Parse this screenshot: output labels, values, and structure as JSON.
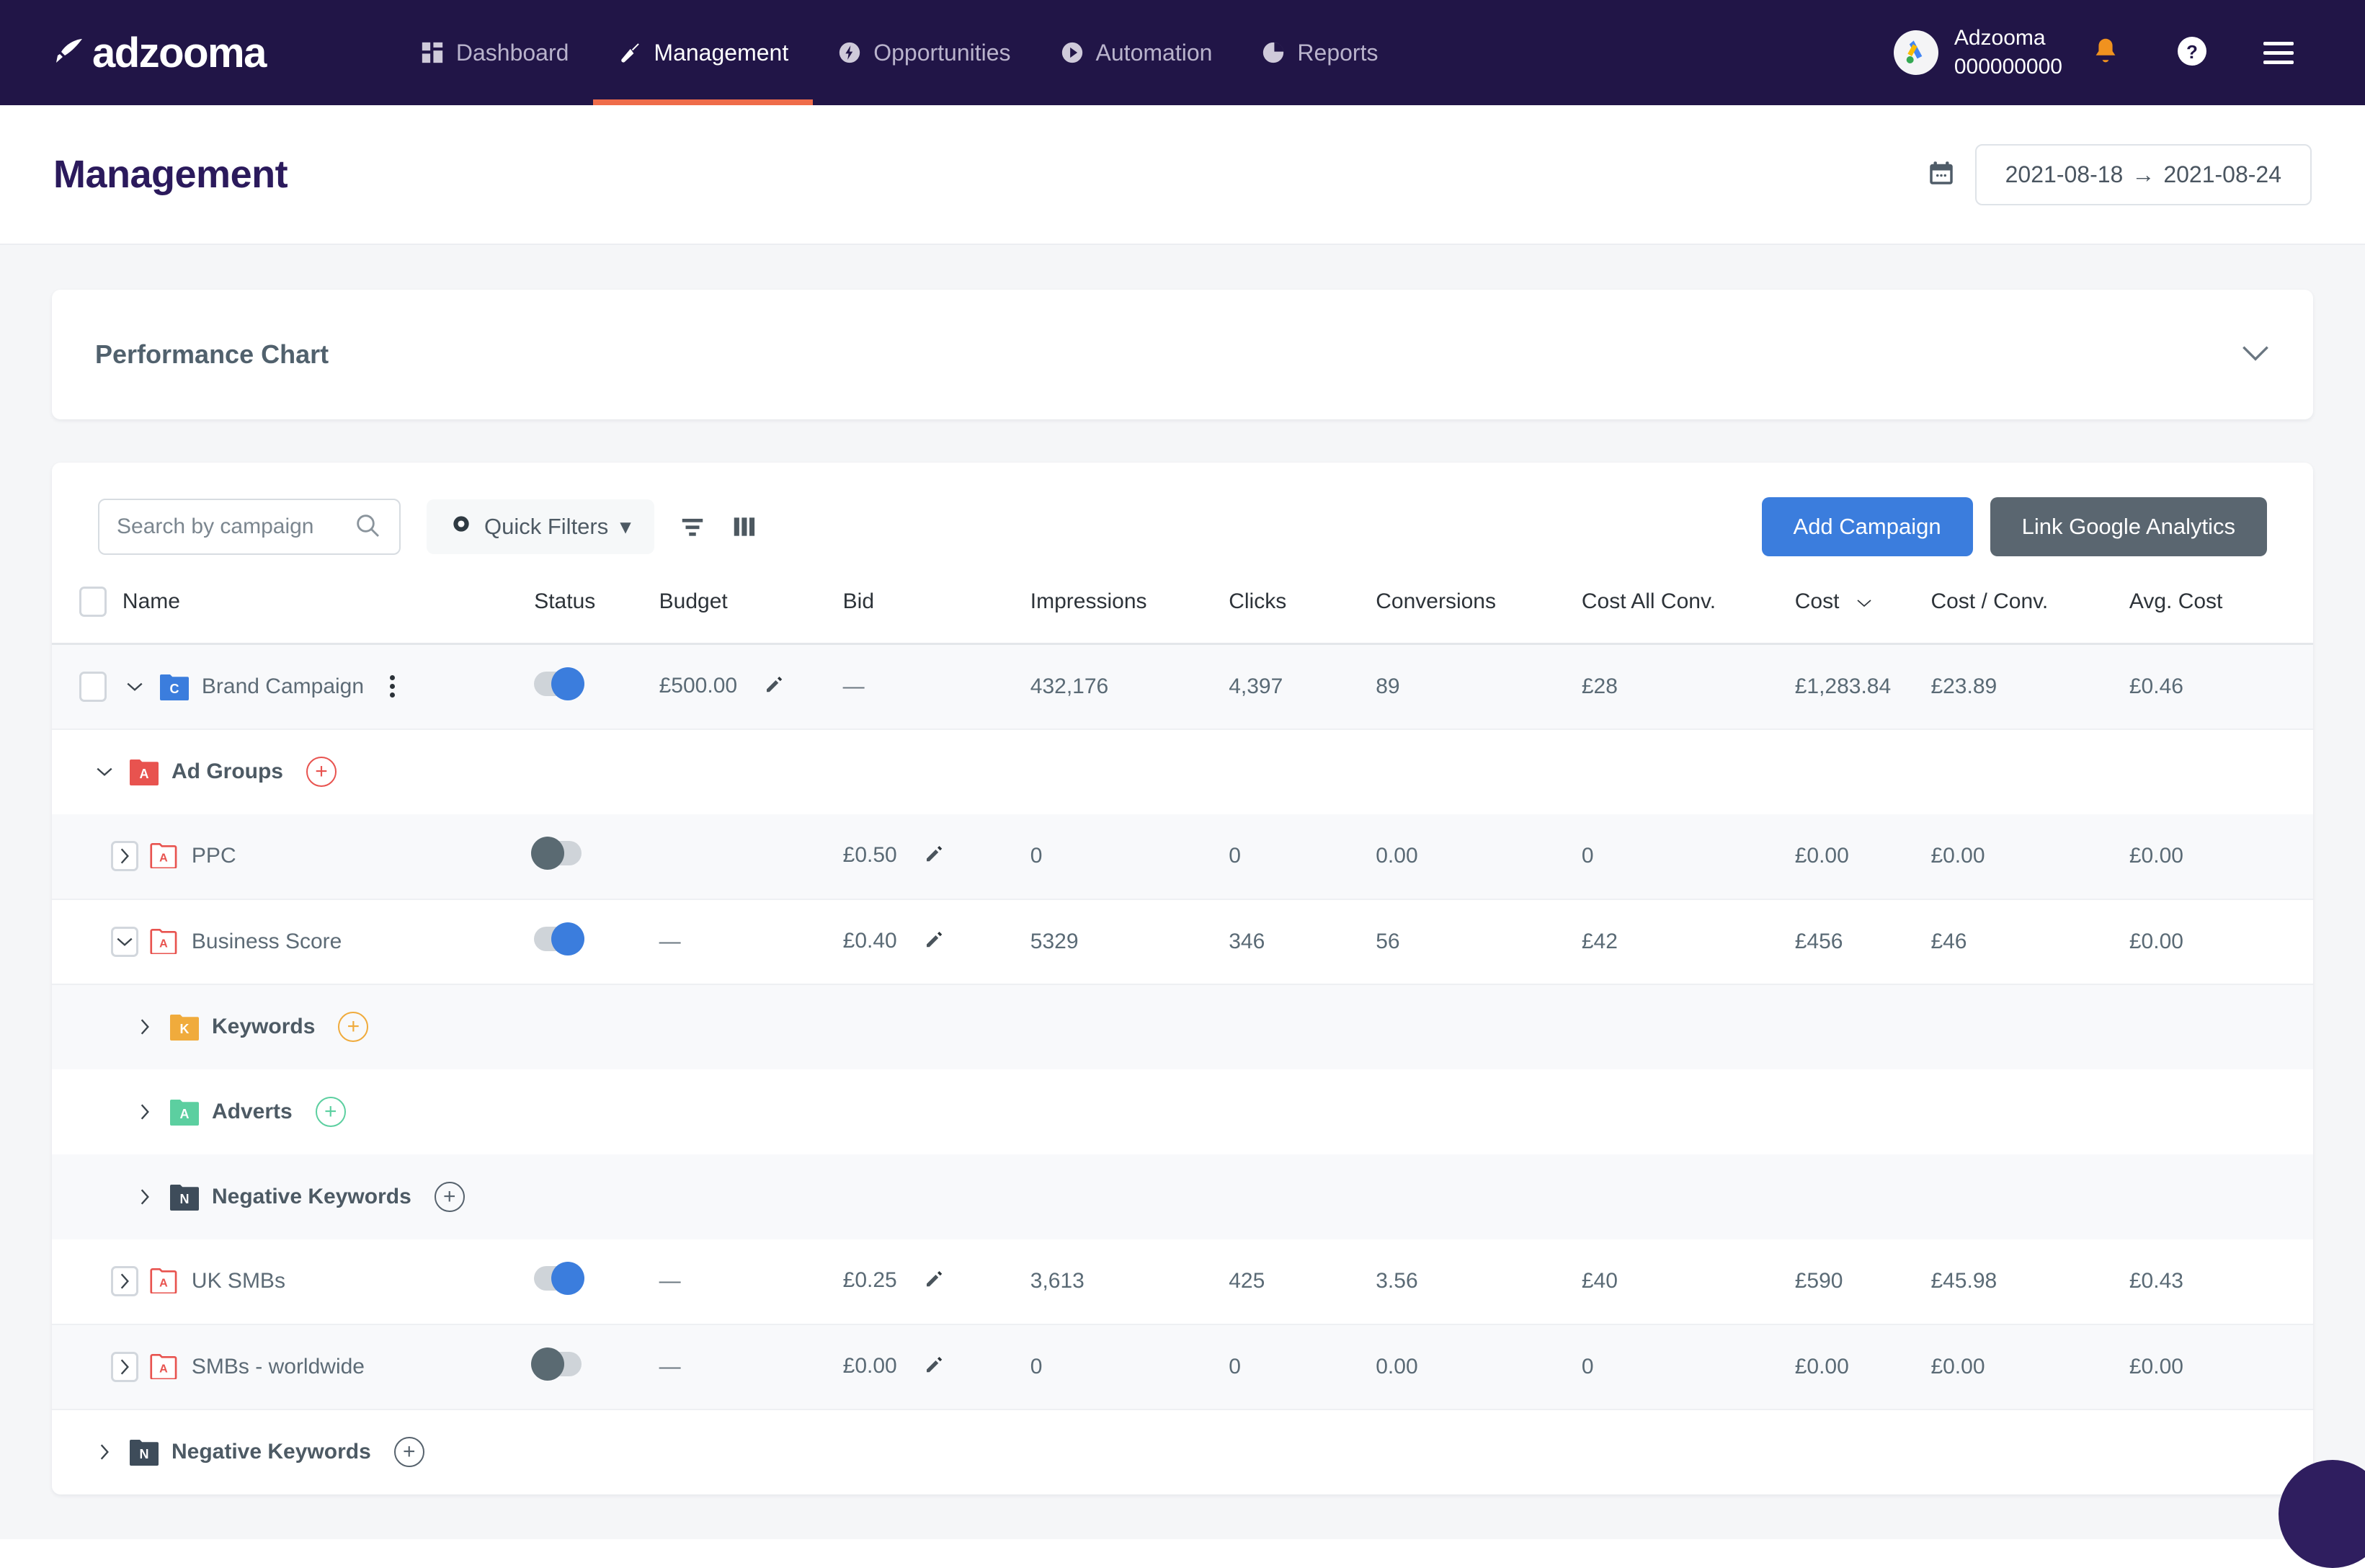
{
  "brand": {
    "logo_text": "adzooma",
    "logo_icon": "rocket-icon"
  },
  "nav": {
    "items": [
      {
        "label": "Dashboard",
        "icon": "dashboard-grid-icon",
        "active": false
      },
      {
        "label": "Management",
        "icon": "wrench-icon",
        "active": true
      },
      {
        "label": "Opportunities",
        "icon": "bolt-circle-icon",
        "active": false
      },
      {
        "label": "Automation",
        "icon": "play-circle-icon",
        "active": false
      },
      {
        "label": "Reports",
        "icon": "pie-chart-icon",
        "active": false
      }
    ],
    "account": {
      "name": "Adzooma",
      "id": "000000000",
      "avatar_icon": "google-ads-icon"
    },
    "notifications_icon": "bell-icon",
    "help_icon": "question-circle-icon",
    "menu_icon": "hamburger-menu-icon"
  },
  "page": {
    "title": "Management",
    "calendar_icon": "calendar-icon",
    "date_start": "2021-08-18",
    "date_arrow": "→",
    "date_end": "2021-08-24"
  },
  "performance_chart": {
    "title": "Performance Chart",
    "chevron_icon": "chevron-down-icon"
  },
  "toolbar": {
    "search_placeholder": "Search by campaign",
    "search_value": "",
    "search_icon": "search-icon",
    "quick_filters_label": "Quick Filters",
    "quick_filters_icon": "eye-icon",
    "quick_filters_caret": "▾",
    "filter_icon": "filter-lines-icon",
    "columns_icon": "columns-icon",
    "add_campaign_label": "Add Campaign",
    "link_ga_label": "Link Google Analytics"
  },
  "table": {
    "columns": [
      {
        "key": "name",
        "label": "Name"
      },
      {
        "key": "status",
        "label": "Status"
      },
      {
        "key": "budget",
        "label": "Budget"
      },
      {
        "key": "bid",
        "label": "Bid"
      },
      {
        "key": "impressions",
        "label": "Impressions"
      },
      {
        "key": "clicks",
        "label": "Clicks"
      },
      {
        "key": "conversions",
        "label": "Conversions"
      },
      {
        "key": "cost_all_conv",
        "label": "Cost All Conv."
      },
      {
        "key": "cost",
        "label": "Cost",
        "sorted": true,
        "sort_icon": "chevron-down-icon"
      },
      {
        "key": "cost_conv",
        "label": "Cost / Conv."
      },
      {
        "key": "avg_cost",
        "label": "Avg. Cost"
      }
    ],
    "rows": [
      {
        "type": "campaign",
        "name": "Brand Campaign",
        "folder_letter": "C",
        "folder_color": "#3b7ddd",
        "caret": "down",
        "toggle": "on",
        "kebab": true,
        "budget": "£500.00",
        "budget_editable": true,
        "bid": "—",
        "bid_editable": false,
        "impressions": "432,176",
        "clicks": "4,397",
        "conversions": "89",
        "cost_all_conv": "£28",
        "cost": "£1,283.84",
        "cost_conv": "£23.89",
        "avg_cost": "£0.46"
      },
      {
        "type": "group-header",
        "name": "Ad Groups",
        "folder_letter": "A",
        "folder_color": "#e8534f",
        "caret": "down",
        "plus_color": "#e8534f"
      },
      {
        "type": "adgroup",
        "name": "PPC",
        "folder_letter": "A",
        "folder_color": "#ffffff",
        "folder_border": "#e8534f",
        "folder_text": "#e8534f",
        "caret": "right",
        "toggle": "off",
        "budget": "",
        "bid": "£0.50",
        "bid_editable": true,
        "impressions": "0",
        "clicks": "0",
        "conversions": "0.00",
        "cost_all_conv": "0",
        "cost": "£0.00",
        "cost_conv": "£0.00",
        "avg_cost": "£0.00"
      },
      {
        "type": "adgroup",
        "name": "Business Score",
        "folder_letter": "A",
        "folder_color": "#ffffff",
        "folder_border": "#e8534f",
        "folder_text": "#e8534f",
        "caret": "down",
        "toggle": "on",
        "budget": "—",
        "bid": "£0.40",
        "bid_editable": true,
        "impressions": "5329",
        "clicks": "346",
        "conversions": "56",
        "cost_all_conv": "£42",
        "cost": "£456",
        "cost_conv": "£46",
        "avg_cost": "£0.00"
      },
      {
        "type": "group-header",
        "name": "Keywords",
        "folder_letter": "K",
        "folder_color": "#f0ab3c",
        "caret": "right",
        "plus_color": "#f0ab3c",
        "indent": 2
      },
      {
        "type": "group-header",
        "name": "Adverts",
        "folder_letter": "A",
        "folder_color": "#5ccfa0",
        "caret": "right",
        "plus_color": "#5ccfa0",
        "indent": 2
      },
      {
        "type": "group-header",
        "name": "Negative Keywords",
        "folder_letter": "N",
        "folder_color": "#3e4c5a",
        "caret": "right",
        "plus_color": "#56626d",
        "indent": 2
      },
      {
        "type": "adgroup",
        "name": "UK SMBs",
        "folder_letter": "A",
        "folder_color": "#ffffff",
        "folder_border": "#e8534f",
        "folder_text": "#e8534f",
        "caret": "right",
        "toggle": "on",
        "budget": "—",
        "bid": "£0.25",
        "bid_editable": true,
        "impressions": "3,613",
        "clicks": "425",
        "conversions": "3.56",
        "cost_all_conv": "£40",
        "cost": "£590",
        "cost_conv": "£45.98",
        "avg_cost": "£0.43"
      },
      {
        "type": "adgroup",
        "name": "SMBs - worldwide",
        "folder_letter": "A",
        "folder_color": "#ffffff",
        "folder_border": "#e8534f",
        "folder_text": "#e8534f",
        "caret": "right",
        "toggle": "off",
        "budget": "—",
        "bid": "£0.00",
        "bid_editable": true,
        "impressions": "0",
        "clicks": "0",
        "conversions": "0.00",
        "cost_all_conv": "0",
        "cost": "£0.00",
        "cost_conv": "£0.00",
        "avg_cost": "£0.00"
      },
      {
        "type": "group-header",
        "name": "Negative Keywords",
        "folder_letter": "N",
        "folder_color": "#3e4c5a",
        "caret": "right",
        "plus_color": "#56626d",
        "indent": 1
      }
    ]
  },
  "colors": {
    "nav_bg": "#211547",
    "accent_orange": "#ef6c4a",
    "primary_blue": "#3b7ddd",
    "secondary_grey": "#5a6670",
    "page_bg": "#f5f6f8"
  }
}
